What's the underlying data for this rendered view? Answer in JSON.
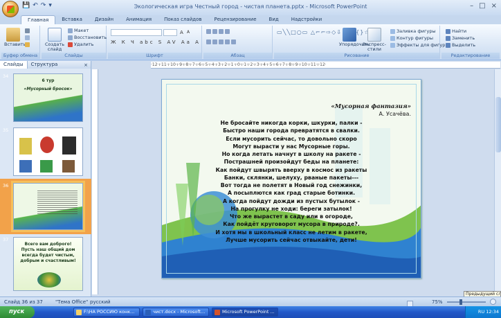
{
  "window": {
    "title": "Экологическая игра Честный город - чистая планета.pptx - Microsoft PowerPoint",
    "qat": [
      "💾",
      "↶",
      "↷",
      "▾"
    ],
    "controls": [
      "–",
      "□",
      "×"
    ]
  },
  "ribbon_tabs": [
    "Главная",
    "Вставка",
    "Дизайн",
    "Анимация",
    "Показ слайдов",
    "Рецензирование",
    "Вид",
    "Надстройки"
  ],
  "ribbon": {
    "clipboard": {
      "paste": "Вставить",
      "label": "Буфер обмена"
    },
    "slides": {
      "create": "Создать слайд",
      "layout": "Макет",
      "reset": "Восстановить",
      "delete": "Удалить",
      "label": "Слайды"
    },
    "font": {
      "label": "Шрифт",
      "grow": "A",
      "shrink": "A",
      "format_glyphs": "Ж К Ч abc S AV Aa A"
    },
    "paragraph": {
      "label": "Абзац"
    },
    "drawing": {
      "arrange": "Упорядочить",
      "quick_styles": "Экспресс-стили",
      "fill": "Заливка фигуры",
      "outline": "Контур фигуры",
      "effects": "Эффекты для фигур",
      "label": "Рисование"
    },
    "editing": {
      "find": "Найти",
      "replace": "Заменить",
      "select": "Выделить",
      "label": "Редактирование"
    }
  },
  "pane": {
    "tabs": [
      "Слайды",
      "Структура"
    ],
    "close": "×",
    "thumbs": [
      {
        "num": "34",
        "title": "6 тур",
        "subtitle": "«Мусорный бросок»"
      },
      {
        "num": "35"
      },
      {
        "num": "36"
      },
      {
        "num": "37",
        "text": "Всего вам доброго! Пусть наш общий дом всегда будет чистым, добрым и счастливым!"
      }
    ]
  },
  "ruler": "·12·ı·11·ı·10·ı·9·ı·8·ı·7·ı·6·ı·5·ı·4·ı·3·ı·2·ı·1·ı·0·ı·1·ı·2·ı·3·ı·4·ı·5·ı·6·ı·7·ı·8·ı·9·ı·10·ı·11·ı·12·",
  "slide": {
    "title": "«Мусорная фантазия»",
    "author": "А. Усачёва.",
    "lines": [
      "Не бросайте никогда корки, шкурки, палки -",
      "Быстро наши города превратятся в свалки.",
      "Если мусорить сейчас, то довольно скоро",
      "Могут вырасти у нас Мусорные горы.",
      "Но когда летать начнут в школу на ракете -",
      "Пострашней произойдут беды на планете:",
      "Как пойдут швырять вверху в космос из ракеты",
      "Банки, склянки, шелуху, рваные пакеты---",
      "Вот тогда не полетят в Новый год снежинки,",
      "А посыплются как град старые ботинки.",
      "А когда пойдут дожди из пустых бутылок -",
      "На прогулку не ходи: береги затылок!",
      "Что же вырастет в саду или в огороде,",
      "Как пойдёт круговорот мусора в природе?.",
      "И хотя мы в школьный класс не летим в ракете,",
      "Лучше мусорить сейчас отвыкайте, дети!"
    ]
  },
  "status": {
    "slide_info": "Слайд 36 из 37",
    "theme": "\"Тема Office\"",
    "language": "русский",
    "zoom": "75%"
  },
  "tooltip": "Предыдущий слайд",
  "taskbar": {
    "start": "пуск",
    "tasks": [
      "F:\\НА РОССИЮ конк...",
      "чист.docx - Microsoft...",
      "Microsoft PowerPoint ..."
    ],
    "clock": "RU  12:34"
  }
}
